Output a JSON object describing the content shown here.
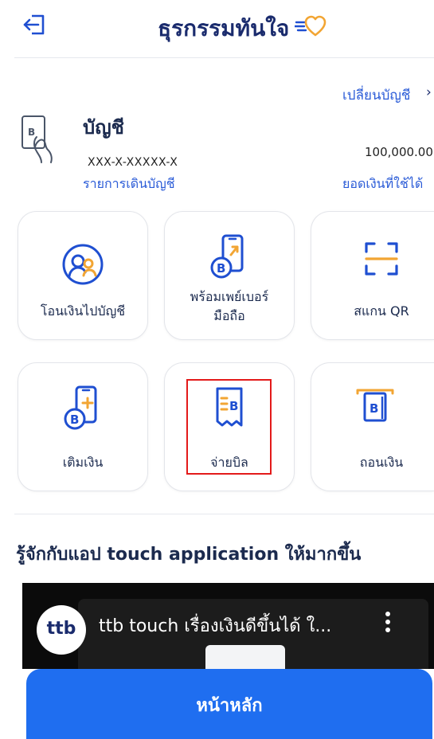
{
  "header": {
    "title": "ธุรกรรมทันใจ"
  },
  "account": {
    "switch_label": "เปลี่ยนบัญชี",
    "title": "บัญชี",
    "number": "XXX-X-XXXXX-X",
    "statement_link": "รายการเดินบัญชี",
    "balance": "100,000.00",
    "balance_label": "ยอดเงินที่ใช้ได้"
  },
  "tiles": [
    {
      "label": "โอนเงินไปบัญชี",
      "icon": "people-transfer-icon"
    },
    {
      "label_line1": "พร้อมเพย์เบอร์",
      "label_line2": "มือถือ",
      "icon": "promptpay-phone-icon"
    },
    {
      "label": "สแกน QR",
      "icon": "qr-scan-icon"
    },
    {
      "label": "เติมเงิน",
      "icon": "topup-phone-icon"
    },
    {
      "label": "จ่ายบิล",
      "icon": "bill-receipt-icon"
    },
    {
      "label": "ถอนเงิน",
      "icon": "atm-withdraw-icon"
    }
  ],
  "section": {
    "title": "รู้จักกับแอป touch application ให้มากขึ้น"
  },
  "video": {
    "logo_text": "ttb",
    "title": "ttb touch เรื่องเงินดีขึ้นได้ ใ..."
  },
  "bottom": {
    "home_label": "หน้าหลัก"
  },
  "colors": {
    "brand_navy": "#1a2b6d",
    "link_blue": "#2a5bd7",
    "icon_blue": "#1f4fd1",
    "icon_orange": "#f2a533",
    "button_blue": "#1f6ef0",
    "highlight_red": "#e31a1a"
  }
}
